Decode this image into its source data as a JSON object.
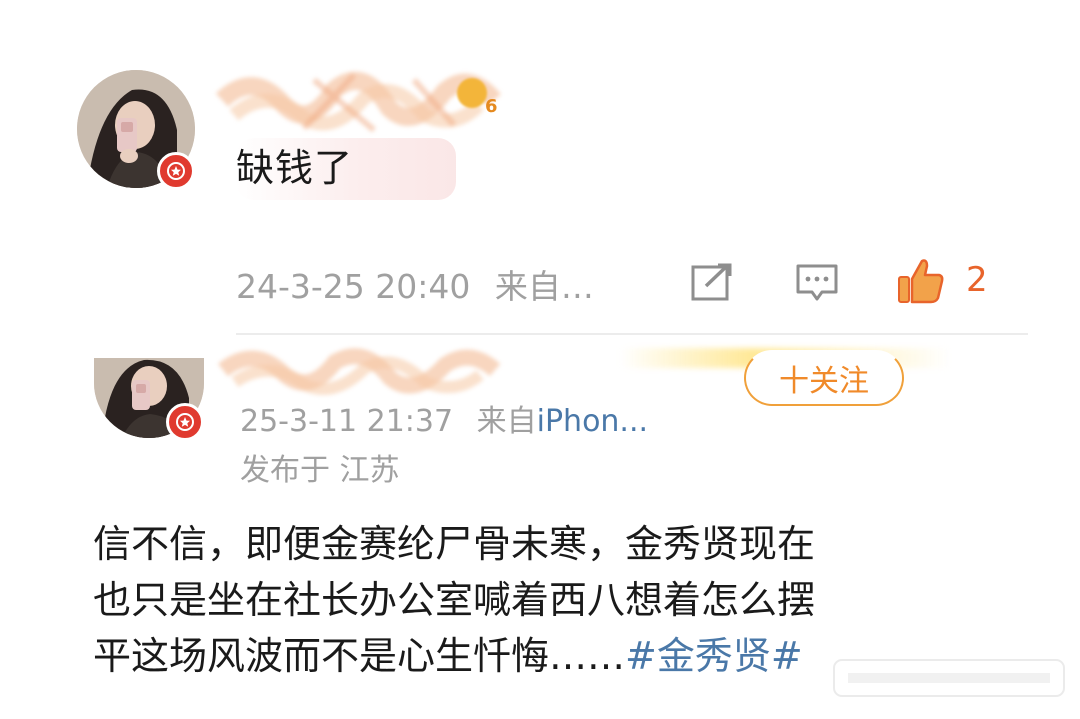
{
  "comment_1": {
    "level": "6",
    "text": "缺钱了",
    "timestamp": "24-3-25 20:40",
    "source_prefix": "来自…",
    "like_count": "2",
    "avatar_icon": "user-avatar-photo",
    "badge_icon": "vip-star-badge"
  },
  "comment_2": {
    "follow_label": "十关注",
    "timestamp": "25-3-11 21:37",
    "source_prefix": "来自",
    "source_device": "iPhon...",
    "location": "发布于 江苏",
    "body_lines": [
      "信不信，即便金赛纶尸骨未寒，金秀贤现在",
      "也只是坐在社长办公室喊着西八想着怎么摆",
      "平这场风波而不是心生忏悔……"
    ],
    "hashtag": "#金秀贤#",
    "avatar_icon": "user-avatar-photo",
    "badge_icon": "vip-star-badge"
  },
  "icons": {
    "share": "share-icon",
    "comment": "comment-icon",
    "like": "thumbs-up-icon"
  },
  "colors": {
    "vip_badge": "#e03a2f",
    "like_active": "#e8642b",
    "link_blue": "#4a78a8",
    "follow_orange": "#f08a2a",
    "meta_gray": "#a0a0a0"
  }
}
